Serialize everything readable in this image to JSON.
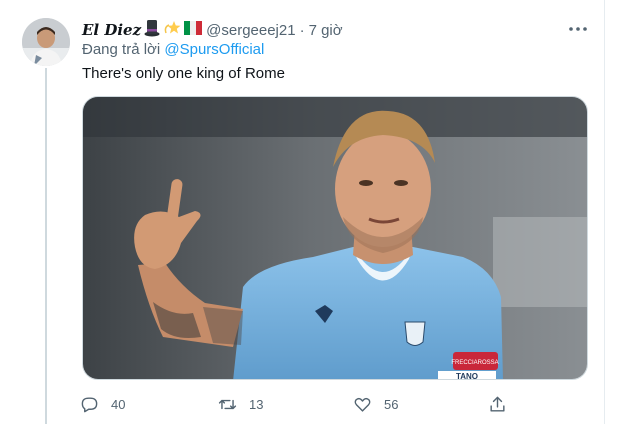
{
  "tweet": {
    "display_name": "El Diez",
    "name_emojis": [
      "top-hat-emoji",
      "dizzy-star-emoji",
      "italy-flag-emoji"
    ],
    "handle": "@sergeeej21",
    "separator": "·",
    "time": "7 giờ",
    "reply_prefix": "Đang trả lời",
    "reply_to": "@SpursOfficial",
    "text": "There's only one king of Rome",
    "image_text": {
      "badge": "FRECCIAROSSA",
      "armband": "TANO"
    },
    "actions": {
      "reply_count": "40",
      "retweet_count": "13",
      "like_count": "56"
    }
  },
  "colors": {
    "text": "#0f1419",
    "muted": "#536471",
    "link": "#1d9bf0",
    "divider": "#cfd9de",
    "jersey": "#7fb6e3"
  },
  "icons": [
    "more-icon",
    "reply-icon",
    "retweet-icon",
    "like-icon",
    "share-icon"
  ]
}
